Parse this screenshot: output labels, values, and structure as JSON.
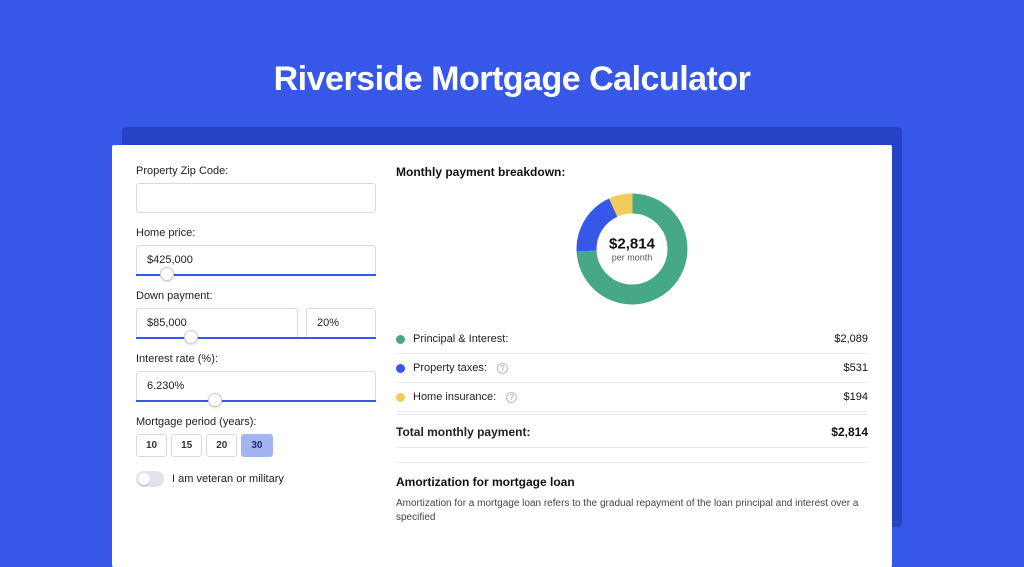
{
  "hero": {
    "title": "Riverside Mortgage Calculator"
  },
  "form": {
    "zip_label": "Property Zip Code:",
    "zip_value": "",
    "price_label": "Home price:",
    "price_value": "$425,000",
    "price_slider_pos": 10,
    "down_label": "Down payment:",
    "down_amount": "$85,000",
    "down_percent": "20%",
    "down_slider_pos": 20,
    "rate_label": "Interest rate (%):",
    "rate_value": "6.230%",
    "rate_slider_pos": 30,
    "period_label": "Mortgage period (years):",
    "periods": [
      "10",
      "15",
      "20",
      "30"
    ],
    "period_selected": "30",
    "veteran_label": "I am veteran or military"
  },
  "breakdown": {
    "title": "Monthly payment breakdown:",
    "center_amount": "$2,814",
    "center_sub": "per month",
    "items": [
      {
        "color": "green",
        "label": "Principal & Interest:",
        "value": "$2,089",
        "info": false
      },
      {
        "color": "blue",
        "label": "Property taxes:",
        "value": "$531",
        "info": true
      },
      {
        "color": "yellow",
        "label": "Home insurance:",
        "value": "$194",
        "info": true
      }
    ],
    "total_label": "Total monthly payment:",
    "total_value": "$2,814"
  },
  "amort": {
    "title": "Amortization for mortgage loan",
    "text": "Amortization for a mortgage loan refers to the gradual repayment of the loan principal and interest over a specified"
  },
  "chart_data": {
    "type": "pie",
    "title": "Monthly payment breakdown",
    "series": [
      {
        "name": "Principal & Interest",
        "value": 2089,
        "color": "#47A886"
      },
      {
        "name": "Property taxes",
        "value": 531,
        "color": "#3657E7"
      },
      {
        "name": "Home insurance",
        "value": 194,
        "color": "#F0CC5A"
      }
    ],
    "total": 2814
  }
}
